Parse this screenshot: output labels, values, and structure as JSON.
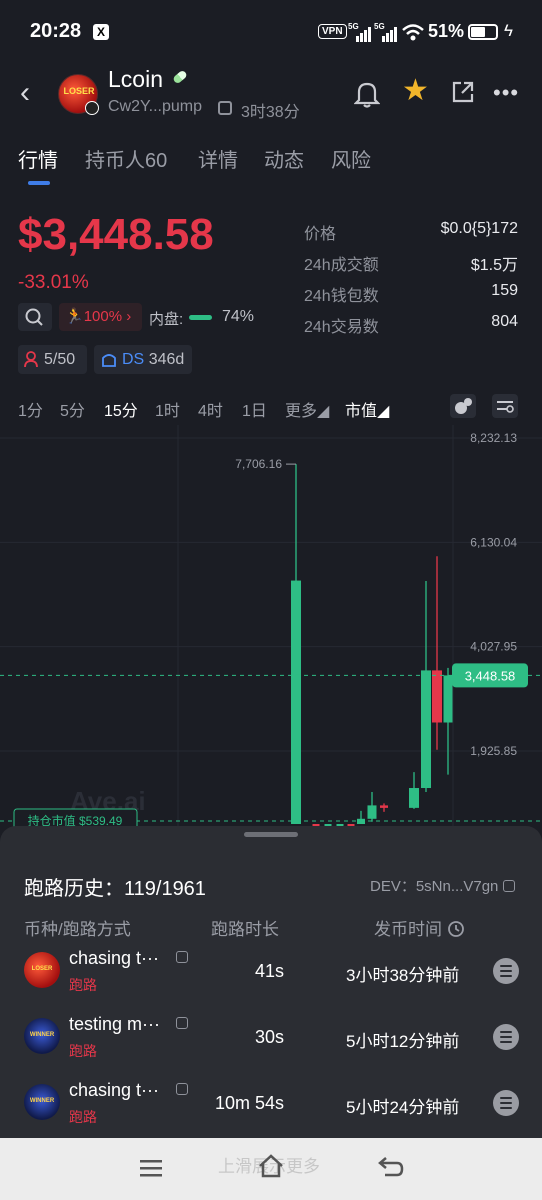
{
  "status_bar": {
    "time": "20:28",
    "x_badge": "X",
    "vpn": "VPN",
    "net1": "5G",
    "net2": "5G",
    "battery": "51%"
  },
  "header": {
    "coin_name": "Lcoin",
    "avatar_text": "LOSER",
    "address": "Cw2Y...pump",
    "age": "3时38分"
  },
  "tabs": [
    "行情",
    "持币人60",
    "详情",
    "动态",
    "风险"
  ],
  "price_block": {
    "price": "$3,448.58",
    "change": "-33.01%",
    "rug_pct": "100%",
    "inner_label": "内盘:",
    "inner_pct": "74%",
    "inner_fraction": 0.74,
    "holders_chip": "5/50",
    "ds_label": "DS",
    "ds_age": "346d"
  },
  "stats": [
    {
      "label": "价格",
      "value": "$0.0{5}172"
    },
    {
      "label": "24h成交额",
      "value": "$1.5万"
    },
    {
      "label": "24h钱包数",
      "value": "159"
    },
    {
      "label": "24h交易数",
      "value": "804"
    }
  ],
  "intervals": [
    "1分",
    "5分",
    "15分",
    "1时",
    "4时",
    "1日",
    "更多",
    "市值"
  ],
  "active_interval": "15分",
  "chart_data": {
    "type": "candlestick",
    "y_ticks": [
      "8,232.13",
      "6,130.04",
      "4,027.95",
      "1,925.85"
    ],
    "high_label": "7,706.16",
    "current_label": "3,448.58",
    "holding_label": "持仓市值 $539.49",
    "watermark": "Ave.ai",
    "candles": [
      {
        "open": 0,
        "close": 5360,
        "high": 7706.16,
        "low": 0
      },
      {
        "open": 280,
        "close": 250,
        "high": 300,
        "low": 200
      },
      {
        "open": 260,
        "close": 300,
        "high": 340,
        "low": 230
      },
      {
        "open": 300,
        "close": 330,
        "high": 360,
        "low": 260
      },
      {
        "open": 330,
        "close": 310,
        "high": 380,
        "low": 280
      },
      {
        "open": 310,
        "close": 560,
        "high": 720,
        "low": 280
      },
      {
        "open": 560,
        "close": 830,
        "high": 1100,
        "low": 500
      },
      {
        "open": 830,
        "close": 780,
        "high": 870,
        "low": 700
      },
      {
        "open": 780,
        "close": 1180,
        "high": 1500,
        "low": 760
      },
      {
        "open": 1180,
        "close": 3550,
        "high": 5350,
        "low": 1100
      },
      {
        "open": 3550,
        "close": 2500,
        "high": 5850,
        "low": 1950
      },
      {
        "open": 2500,
        "close": 3448.58,
        "high": 3600,
        "low": 1450
      }
    ]
  },
  "sheet": {
    "title": "跑路历史：119/1961",
    "dev": "DEV：5sNn...V7gn",
    "col_coin": "币种/跑路方式",
    "col_duration": "跑路时长",
    "col_time": "发币时间",
    "rows": [
      {
        "name": "chasing t···",
        "tag": "跑路",
        "duration": "41s",
        "time": "3小时38分钟前",
        "avatar": "LOSER"
      },
      {
        "name": "testing m···",
        "tag": "跑路",
        "duration": "30s",
        "time": "5小时12分钟前",
        "avatar": "WINNER"
      },
      {
        "name": "chasing t···",
        "tag": "跑路",
        "duration": "10m 54s",
        "time": "5小时24分钟前",
        "avatar": "WINNER"
      }
    ]
  },
  "nav_hint": "上滑展示更多",
  "colors": {
    "up": "#2ebd85",
    "down": "#e5374a",
    "accent": "#3f7de8",
    "star": "#f1b52b"
  }
}
